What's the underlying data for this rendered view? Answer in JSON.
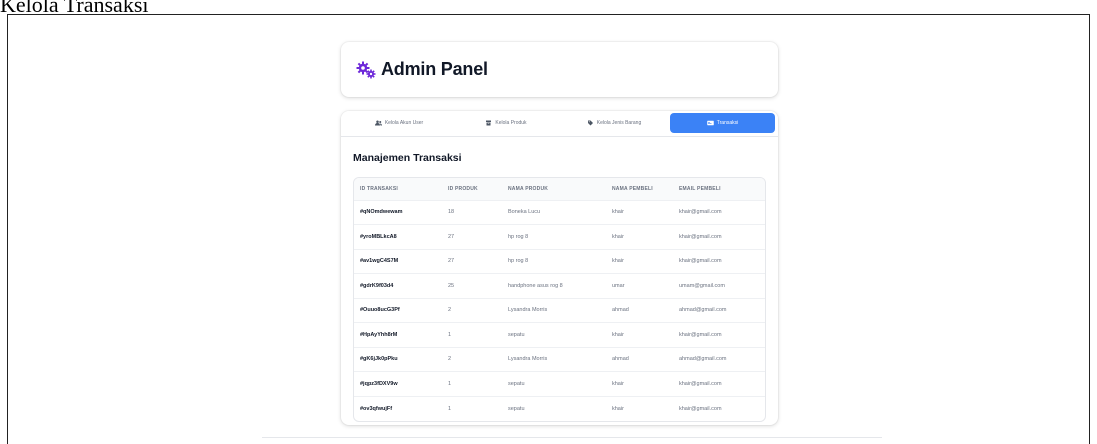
{
  "document": {
    "heading": "Kelola Transaksi"
  },
  "header": {
    "title": "Admin Panel",
    "logo_icon": "cogs-icon",
    "accent": "#6d28d9"
  },
  "tabs": [
    {
      "label": "Kelola Akun User",
      "icon": "users-icon",
      "active": false
    },
    {
      "label": "Kelola Produk",
      "icon": "box-icon",
      "active": false
    },
    {
      "label": "Kelola Jenis Barang",
      "icon": "tag-icon",
      "active": false
    },
    {
      "label": "Transaksi",
      "icon": "receipt-icon",
      "active": true
    }
  ],
  "active_tab_color": "#3b82f6",
  "main": {
    "title": "Manajemen Transaksi",
    "columns": [
      "ID TRANSAKSI",
      "ID PRODUK",
      "NAMA PRODUK",
      "NAMA PEMBELI",
      "EMAIL PEMBELI"
    ],
    "rows": [
      [
        "#qNOmdwewam",
        "18",
        "Boneka Lucu",
        "khair",
        "khair@gmail.com"
      ],
      [
        "#yroMBLkcA8",
        "27",
        "hp rog 8",
        "khair",
        "khair@gmail.com"
      ],
      [
        "#av1wgC4S7M",
        "27",
        "hp rog 8",
        "khair",
        "khair@gmail.com"
      ],
      [
        "#gdrK9f03d4",
        "25",
        "handphone asus rog 8",
        "umar",
        "umam@gmail.com"
      ],
      [
        "#Ouuo8ucG3Pf",
        "2",
        "Lysandra Morris",
        "ahmad",
        "ahmad@gmail.com"
      ],
      [
        "#HpAyYhh8rM",
        "1",
        "sepatu",
        "khair",
        "khair@gmail.com"
      ],
      [
        "#gK6jJk0pPku",
        "2",
        "Lysandra Morris",
        "ahmad",
        "ahmad@gmail.com"
      ],
      [
        "#jqpz3fDXV9w",
        "1",
        "sepatu",
        "khair",
        "khair@gmail.com"
      ],
      [
        "#ov3qfwujFf",
        "1",
        "sepatu",
        "khair",
        "khair@gmail.com"
      ]
    ]
  }
}
